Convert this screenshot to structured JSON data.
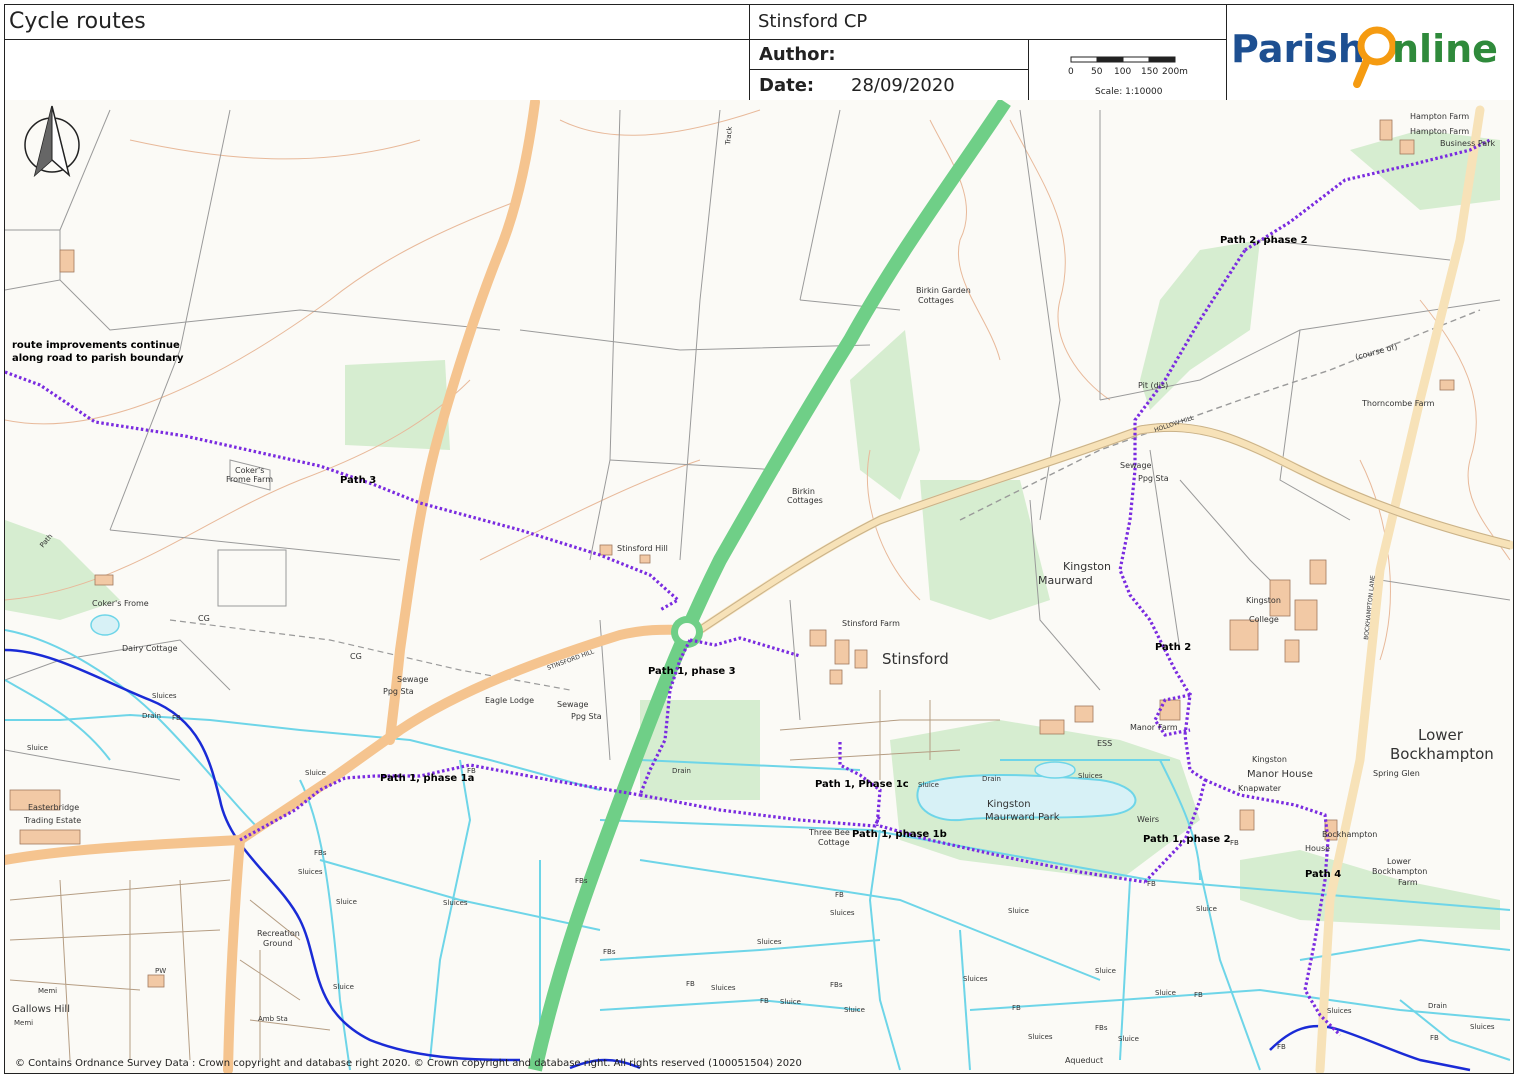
{
  "header": {
    "title": "Cycle routes",
    "parish": "Stinsford CP",
    "author_label": "Author:",
    "author_value": "",
    "date_label": "Date:",
    "date_value": "28/09/2020",
    "logo_part1": "Parish",
    "logo_part2": "nline"
  },
  "scale": {
    "ticks": [
      "0",
      "50",
      "100",
      "150",
      "200m"
    ],
    "caption": "Scale: 1:10000"
  },
  "annotation": {
    "line1": "route improvements continue",
    "line2": "along road to parish boundary"
  },
  "routes": {
    "path3": "Path 3",
    "path1_phase3": "Path 1, phase 3",
    "path1_phase1a": "Path 1, phase 1a",
    "path1_phase1c": "Path 1, Phase 1c",
    "path1_phase1b": "Path 1, phase 1b",
    "path1_phase2": "Path 1, phase 2",
    "path2": "Path 2",
    "path2_phase2": "Path 2, phase 2",
    "path4": "Path 4"
  },
  "places": {
    "stinsford": "Stinsford",
    "lower_bockhampton_1": "Lower",
    "lower_bockhampton_2": "Bockhampton",
    "kingston_maurward_1": "Kingston",
    "kingston_maurward_2": "Maurward",
    "km_park_1": "Kingston",
    "km_park_2": "Maurward Park",
    "birkin_garden_1": "Birkin Garden",
    "birkin_garden_2": "Cottages",
    "birkin_cottages_1": "Birkin",
    "birkin_cottages_2": "Cottages",
    "stinsford_hill": "Stinsford Hill",
    "stinsford_farm": "Stinsford Farm",
    "cokers_frome_farm_1": "Coker's",
    "cokers_frome_farm_2": "Frome Farm",
    "cokers_frome": "Coker's Frome",
    "dairy_cottage": "Dairy Cottage",
    "eagle_lodge": "Eagle Lodge",
    "sewage_1": "Sewage",
    "ppg_sta_1": "Ppg Sta",
    "sewage_2": "Sewage",
    "ppg_sta_2": "Ppg Sta",
    "sewage_3": "Sewage",
    "ppg_sta_3": "Ppg Sta",
    "hampton_farm_1": "Hampton Farm",
    "hampton_farm_2": "Hampton Farm",
    "business_park": "Business Park",
    "thorncombe_farm": "Thorncombe Farm",
    "kingston_college_1": "Kingston",
    "kingston_college_2": "College",
    "manor_farm_1": "Manor",
    "manor_farm_2": "Farm",
    "kingston_manor_house_1": "Kingston",
    "kingston_manor_house_2": "Manor House",
    "knapwater": "Knapwater",
    "spring_glen": "Spring Glen",
    "bockhampton_house_1": "Bockhampton",
    "bockhampton_house_2": "House",
    "lower_bockhampton_farm_1": "Lower",
    "lower_bockhampton_farm_2": "Bockhampton",
    "lower_bockhampton_farm_3": "Farm",
    "three_bee_1": "Three Bee",
    "three_bee_2": "Cottage",
    "easterbridge_1": "Easterbridge",
    "easterbridge_2": "Trading Estate",
    "recreation_1": "Recreation",
    "recreation_2": "Ground",
    "gallows_hill": "Gallows Hill",
    "course_of": "(course of)",
    "hollow_hill": "HOLLOW HILL",
    "stinsford_hill_road": "STINSFORD HILL",
    "bockhampton_lane": "BOCKHAMPTON LANE",
    "track": "Track",
    "weirs": "Weirs",
    "aqueduct": "Aqueduct",
    "pits": "Pit (dis)",
    "ess": "ESS",
    "cg1": "CG",
    "cg2": "CG"
  },
  "small_labels": {
    "sluice": "Sluice",
    "sluices": "Sluices",
    "drain": "Drain",
    "fb": "FB",
    "fbs": "FBs",
    "path": "Path",
    "memi": "Memi",
    "pw": "PW",
    "amb_sta": "Amb Sta"
  },
  "copyright": "© Contains Ordnance Survey Data : Crown copyright and database right 2020. © Crown copyright and database right. All rights reserved (100051504) 2020",
  "colors": {
    "route": "#7a2be0",
    "road_primary": "#6fcf87",
    "road_b": "#f5c48f",
    "road_minor": "#f7e2b8",
    "water": "#6ed5e8",
    "river": "#1a2bd6",
    "woodland": "#cfe9c8",
    "building": "#f2c9a5",
    "logo_blue": "#1d4f91",
    "logo_orange": "#f59b11",
    "logo_green": "#2f8a3b"
  }
}
